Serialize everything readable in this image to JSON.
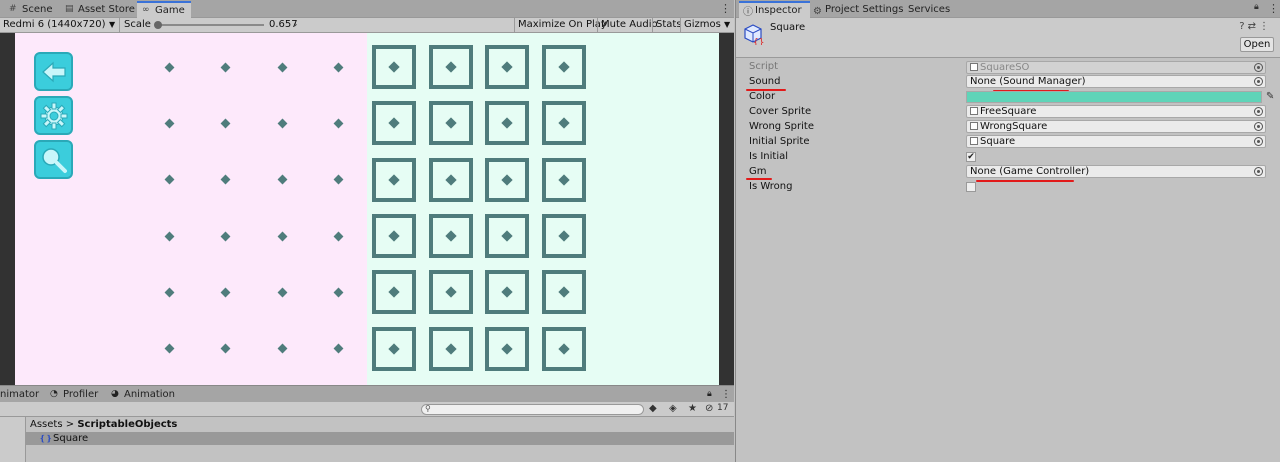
{
  "game_panel": {
    "tabs": [
      {
        "label": "Scene",
        "icon": "scene-icon"
      },
      {
        "label": "Asset Store",
        "icon": "store-icon"
      },
      {
        "label": "Game",
        "icon": "game-icon",
        "active": true
      }
    ],
    "toolbar": {
      "resolution": "Redmi 6 (1440x720)",
      "scale_label": "Scale",
      "scale_value": "0.657",
      "scale_fraction": 0.05,
      "maximize": "Maximize On Play",
      "mute": "Mute Audio",
      "stats": "Stats",
      "gizmos": "Gizmos"
    },
    "canvas": {
      "left_bg": "#fde9fb",
      "right_bg": "#e6fdf4",
      "accent": "#3bcddc",
      "mark_color": "#4f7c7c",
      "side_buttons": [
        {
          "name": "back-arrow-icon"
        },
        {
          "name": "settings-gear-icon"
        },
        {
          "name": "zoom-magnifier-icon"
        }
      ],
      "dot_rows": 6,
      "dot_cols": 4,
      "grid_rows": 6,
      "grid_cols": 4
    }
  },
  "bottom_panel": {
    "tabs": [
      "nimator",
      "Profiler",
      "Animation"
    ],
    "search_placeholder": "",
    "hidden_count": "17",
    "breadcrumb_root": "Assets",
    "breadcrumb_sep": ">",
    "breadcrumb_current": "ScriptableObjects",
    "selected_asset": "Square"
  },
  "inspector": {
    "tabs": [
      {
        "label": "Inspector",
        "icon": "info-icon",
        "active": true
      },
      {
        "label": "Project Settings",
        "icon": "gear-icon"
      },
      {
        "label": "Services",
        "icon": ""
      }
    ],
    "object_name": "Square",
    "open_label": "Open",
    "properties": [
      {
        "label": "Script",
        "value": "SquareSO",
        "kind": "field",
        "disabled": true
      },
      {
        "label": "Sound",
        "value": "None (Sound Manager)",
        "kind": "field",
        "highlighted": true
      },
      {
        "label": "Color",
        "value": "#5fd4b8",
        "kind": "color"
      },
      {
        "label": "Cover Sprite",
        "value": "FreeSquare",
        "kind": "sprite"
      },
      {
        "label": "Wrong Sprite",
        "value": "WrongSquare",
        "kind": "sprite"
      },
      {
        "label": "Initial Sprite",
        "value": "Square",
        "kind": "sprite"
      },
      {
        "label": "Is Initial",
        "value": true,
        "kind": "checkbox"
      },
      {
        "label": "Gm",
        "value": "None (Game Controller)",
        "kind": "field",
        "highlighted": true
      },
      {
        "label": "Is Wrong",
        "value": false,
        "kind": "checkbox"
      }
    ],
    "annotation_color": "#e21a1a"
  }
}
